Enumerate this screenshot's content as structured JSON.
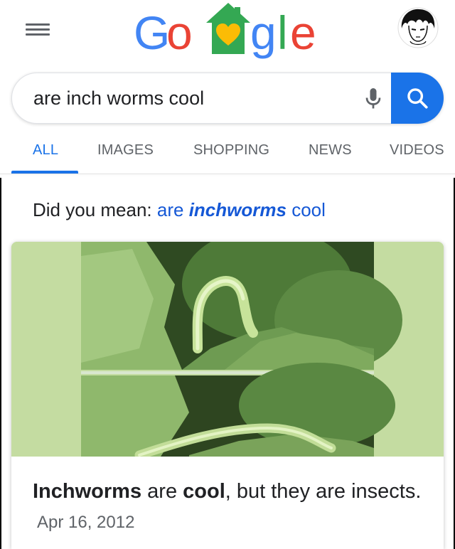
{
  "header": {
    "logo_text": "Google",
    "logo_letters": [
      "G",
      "o",
      "g",
      "l",
      "e"
    ],
    "logo_colors": {
      "G": "#4285F4",
      "o": "#EA4335",
      "house_green": "#34A853",
      "heart": "#FBBC05",
      "g": "#4285F4",
      "l": "#34A853",
      "e": "#EA4335"
    },
    "menu_icon": "hamburger-menu-icon",
    "avatar_icon": "user-avatar-icon"
  },
  "search": {
    "query": "are inch worms cool",
    "mic_icon": "microphone-icon",
    "search_icon": "magnifier-icon",
    "accent": "#1a73e8"
  },
  "tabs": [
    {
      "label": "ALL",
      "active": true
    },
    {
      "label": "IMAGES",
      "active": false
    },
    {
      "label": "SHOPPING",
      "active": false
    },
    {
      "label": "NEWS",
      "active": false
    },
    {
      "label": "VIDEOS",
      "active": false
    }
  ],
  "did_you_mean": {
    "prefix": "Did you mean:",
    "link_pre": "are",
    "link_bold": "inchworms",
    "link_post": "cool"
  },
  "result_card": {
    "image_description_icon": "inchworm-photo",
    "text_bold_1": "Inchworms",
    "text_mid_1": "are",
    "text_bold_2": "cool",
    "text_rest": ", but they are insects.",
    "date": "Apr 16, 2012"
  }
}
